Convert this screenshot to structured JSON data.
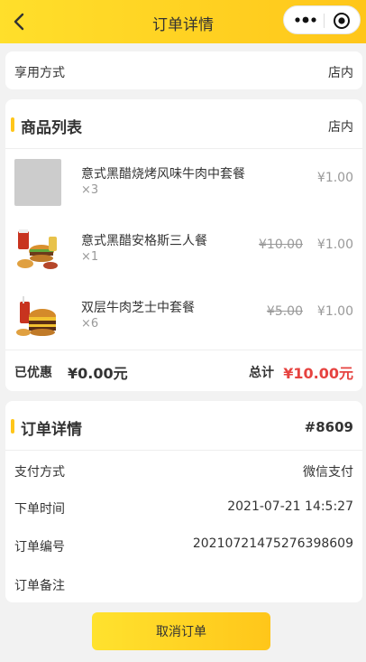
{
  "nav": {
    "title": "订单详情"
  },
  "dining": {
    "label": "享用方式",
    "value": "店内"
  },
  "goods": {
    "title": "商品列表",
    "mode": "店内",
    "items": [
      {
        "name": "意式黑醋烧烤风味牛肉中套餐",
        "qty": "×3",
        "old_price": "",
        "price": "¥1.00"
      },
      {
        "name": "意式黑醋安格斯三人餐",
        "qty": "×1",
        "old_price": "¥10.00",
        "price": "¥1.00"
      },
      {
        "name": "双层牛肉芝士中套餐",
        "qty": "×6",
        "old_price": "¥5.00",
        "price": "¥1.00"
      }
    ],
    "discount_label": "已优惠",
    "discount_value": "¥0.00元",
    "total_label": "总计",
    "total_value": "¥10.00元"
  },
  "order": {
    "title": "订单详情",
    "number": "#8609",
    "rows": [
      {
        "label": "支付方式",
        "value": "微信支付"
      },
      {
        "label": "下单时间",
        "value": "2021-07-21 14:5:27"
      },
      {
        "label": "订单编号",
        "value": "20210721475276398609"
      },
      {
        "label": "订单备注",
        "value": ""
      }
    ]
  },
  "actions": {
    "cancel_label": "取消订单"
  },
  "colors": {
    "accent": "#ffc61a",
    "total": "#e64340"
  }
}
